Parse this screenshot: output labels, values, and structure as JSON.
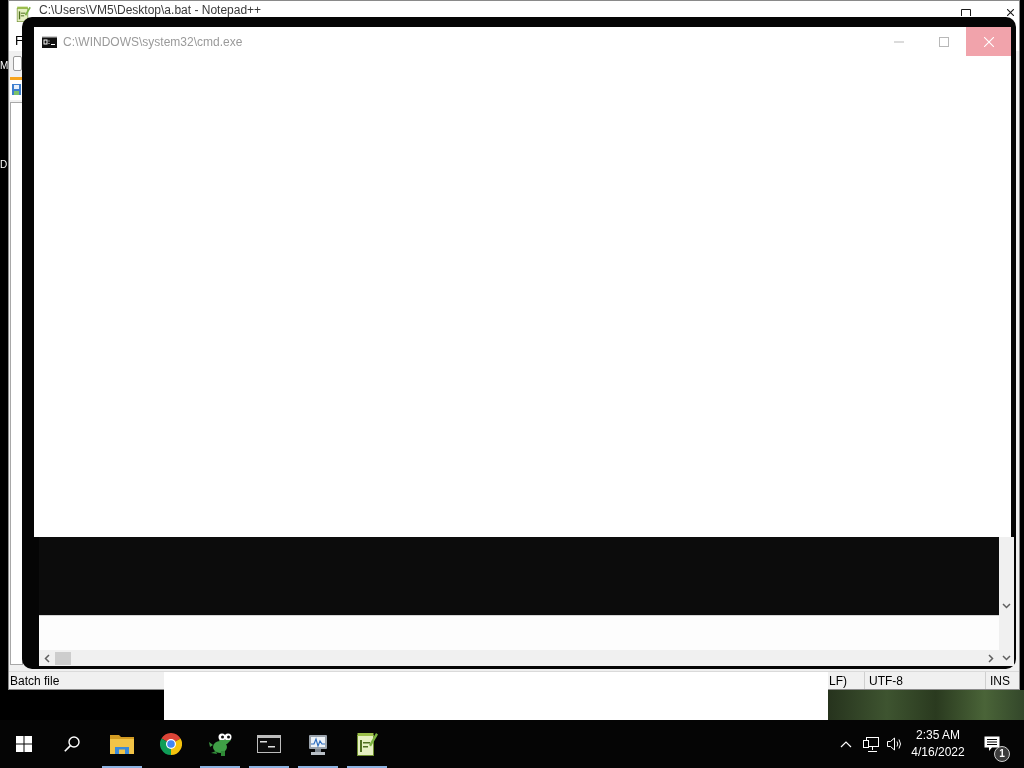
{
  "desktop": {
    "icon_labels": [
      "M",
      "D"
    ]
  },
  "notepad_window": {
    "title": "C:\\Users\\VM5\\Desktop\\a.bat - Notepad++",
    "title_buttons": [
      {
        "kind": "maximize"
      },
      {
        "kind": "close"
      }
    ],
    "menu": [
      "F"
    ],
    "tabs": [
      {
        "selected": true
      }
    ],
    "status_bar": [
      "Batch file",
      "LF)",
      "UTF-8",
      "INS"
    ]
  },
  "console_window": {
    "title": "C:\\WINDOWS\\system32\\cmd.exe",
    "title_buttons": [
      {
        "kind": "minimize",
        "hovered": false
      },
      {
        "kind": "maximize",
        "hovered": false
      },
      {
        "kind": "close",
        "hovered": true
      }
    ]
  },
  "taskbar": {
    "apps": [
      {
        "kind": "folder",
        "running": true
      },
      {
        "kind": "browser",
        "running": false
      },
      {
        "kind": "creature",
        "running": true
      },
      {
        "kind": "terminal",
        "running": true
      },
      {
        "kind": "monitor",
        "running": true
      },
      {
        "kind": "notepad",
        "running": true
      }
    ],
    "tray": {
      "time": "2:35 AM",
      "date": "4/16/2022",
      "notifications": "1"
    }
  }
}
